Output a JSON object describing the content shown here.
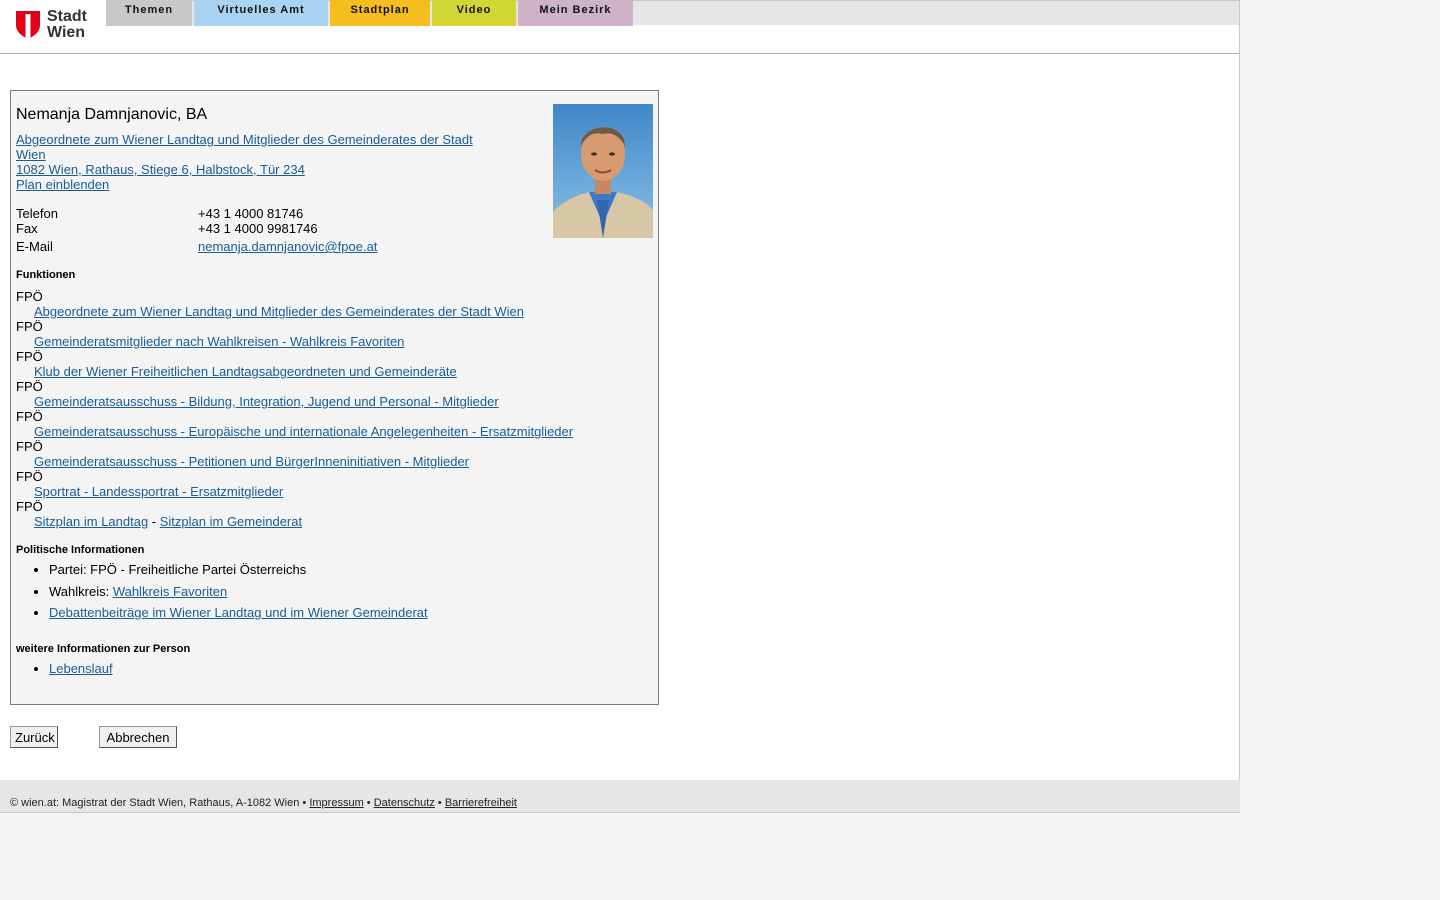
{
  "header": {
    "logo_line1": "Stadt",
    "logo_line2": "Wien",
    "nav": [
      {
        "label": "Themen",
        "color": "#c8c8c8"
      },
      {
        "label": "Virtuelles Amt",
        "color": "#a9d3f0"
      },
      {
        "label": "Stadtplan",
        "color": "#f5be1e"
      },
      {
        "label": "Video",
        "color": "#d2d635"
      },
      {
        "label": "Mein Bezirk",
        "color": "#cfb1c8"
      }
    ]
  },
  "person": {
    "name": "Nemanja Damnjanovic, BA",
    "role_link_line1": "Abgeordnete zum Wiener Landtag und Mitglieder des Gemeinderates der Stadt",
    "role_link_line2": "Wien ",
    "address": "1082 Wien, Rathaus, Stiege 6, Halbstock, Tür 234",
    "plan_link": "Plan einblenden",
    "contact": {
      "phone_label": "Telefon",
      "phone": "+43 1 4000 81746",
      "fax_label": "Fax",
      "fax": "+43 1 4000 9981746",
      "email_label": "E-Mail",
      "email": "nemanja.damnjanovic@fpoe.at"
    }
  },
  "functions": {
    "heading": "Funktionen",
    "items": [
      {
        "party": "FPÖ",
        "role": "Abgeordnete zum Wiener Landtag und Mitglieder des Gemeinderates der Stadt Wien"
      },
      {
        "party": "FPÖ",
        "role": "Gemeinderatsmitglieder nach Wahlkreisen - Wahlkreis Favoriten"
      },
      {
        "party": "FPÖ",
        "role": "Klub der Wiener Freiheitlichen Landtagsabgeordneten und Gemeinderäte"
      },
      {
        "party": "FPÖ",
        "role": "Gemeinderatsausschuss - Bildung, Integration, Jugend und Personal - Mitglieder"
      },
      {
        "party": "FPÖ",
        "role": "Gemeinderatsausschuss - Europäische und internationale Angelegenheiten - Ersatzmitglieder"
      },
      {
        "party": "FPÖ",
        "role": "Gemeinderatsausschuss - Petitionen und BürgerInneninitiativen - Mitglieder"
      },
      {
        "party": "FPÖ",
        "role": "Sportrat - Landessportrat - Ersatzmitglieder"
      }
    ],
    "last_party": "FPÖ",
    "seat_landtag": "Sitzplan im Landtag",
    "seat_sep": " - ",
    "seat_gemeinderat": "Sitzplan im Gemeinderat"
  },
  "political": {
    "heading": "Politische Informationen",
    "party": "Partei: FPÖ - Freiheitliche Partei Österreichs",
    "wahlkreis_label": "Wahlkreis: ",
    "wahlkreis_link": "Wahlkreis Favoriten",
    "debate_link": "Debattenbeiträge im Wiener Landtag und im Wiener Gemeinderat"
  },
  "more": {
    "heading": "weitere Informationen zur Person",
    "cv_link": "Lebenslauf"
  },
  "buttons": {
    "back": "Zurück",
    "cancel": "Abbrechen"
  },
  "footer": {
    "copyright": "© wien.at: Magistrat der Stadt Wien, Rathaus, A-1082 Wien • ",
    "impressum": "Impressum",
    "sep": " • ",
    "datenschutz": "Datenschutz",
    "barrierefreiheit": "Barrierefreiheit"
  }
}
